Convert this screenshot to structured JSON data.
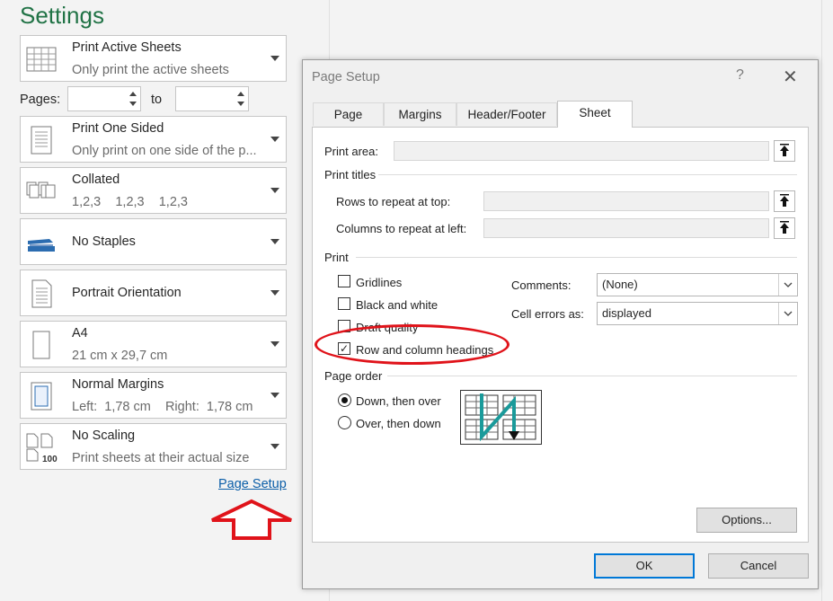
{
  "settings": {
    "title": "Settings",
    "options": [
      {
        "key": "sheets",
        "line1": "Print Active Sheets",
        "line2": "Only print the active sheets",
        "icon": "sheet-grid-icon"
      },
      {
        "key": "sides",
        "line1": "Print One Sided",
        "line2": "Only print on one side of the p...",
        "icon": "one-sided-page-icon"
      },
      {
        "key": "collate",
        "line1": "Collated",
        "line2": "1,2,3    1,2,3    1,2,3",
        "icon": "collated-pages-icon"
      },
      {
        "key": "staples",
        "line1": "No Staples",
        "line2": "",
        "icon": "stapler-icon"
      },
      {
        "key": "orientation",
        "line1": "Portrait Orientation",
        "line2": "",
        "icon": "portrait-page-icon"
      },
      {
        "key": "paper",
        "line1": "A4",
        "line2": "21 cm x 29,7 cm",
        "icon": "paper-size-icon"
      },
      {
        "key": "margins",
        "line1": "Normal Margins",
        "line2": "Left:  1,78 cm    Right:  1,78 cm",
        "icon": "margins-icon"
      },
      {
        "key": "scaling",
        "line1": "No Scaling",
        "line2": "Print sheets at their actual size",
        "icon": "scaling-100-icon",
        "badge": "100"
      }
    ],
    "pages_label": "Pages:",
    "to_label": "to",
    "page_setup_link": "Page Setup"
  },
  "dialog": {
    "title": "Page Setup",
    "help": "?",
    "close": "✕",
    "tabs": [
      {
        "label": "Page"
      },
      {
        "label": "Margins"
      },
      {
        "label": "Header/Footer"
      },
      {
        "label": "Sheet"
      }
    ],
    "print_area_label": "Print area:",
    "print_titles_label": "Print titles",
    "rows_repeat_label": "Rows to repeat at top:",
    "cols_repeat_label": "Columns to repeat at left:",
    "print_group_label": "Print",
    "checkboxes": [
      {
        "label": "Gridlines",
        "checked": false
      },
      {
        "label": "Black and white",
        "checked": false
      },
      {
        "label": "Draft quality",
        "checked": false
      },
      {
        "label": "Row and column headings",
        "checked": true
      }
    ],
    "comments_label": "Comments:",
    "comments_value": "(None)",
    "cell_errors_label": "Cell errors as:",
    "cell_errors_value": "displayed",
    "page_order_label": "Page order",
    "radios": [
      {
        "label": "Down, then over",
        "selected": true
      },
      {
        "label": "Over, then down",
        "selected": false
      }
    ],
    "options_button": "Options...",
    "ok_button": "OK",
    "cancel_button": "Cancel",
    "check_mark": "✓"
  },
  "colors": {
    "settings_title": "#217346",
    "link": "#0b5ea8",
    "highlight": "#e0131a",
    "ok_border": "#0078d7"
  }
}
